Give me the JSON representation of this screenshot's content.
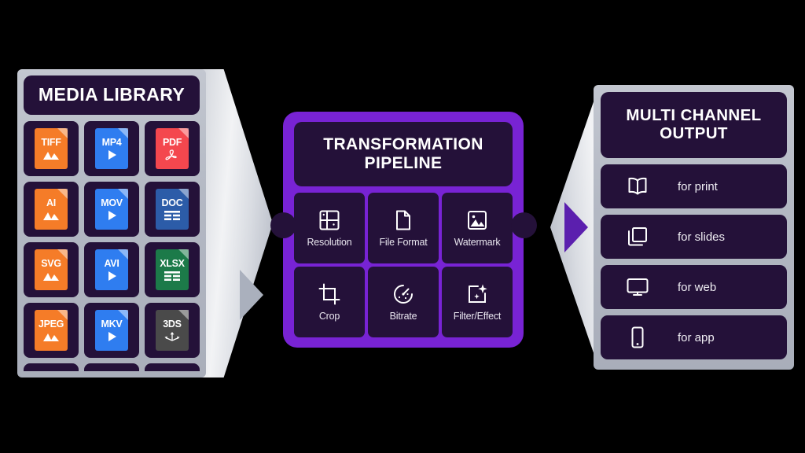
{
  "background_color": "#000000",
  "accent_purple": "#7823D4",
  "panel_dark": "#241139",
  "frame_silver": "#B4B9C4",
  "media_library": {
    "title": "MEDIA LIBRARY",
    "files": [
      {
        "label": "TIFF",
        "color": "#F57C28",
        "glyph": "image-icon"
      },
      {
        "label": "MP4",
        "color": "#2F7DF0",
        "glyph": "play-icon"
      },
      {
        "label": "PDF",
        "color": "#F4474E",
        "glyph": "pdf-icon"
      },
      {
        "label": "AI",
        "color": "#F57C28",
        "glyph": "image-icon"
      },
      {
        "label": "MOV",
        "color": "#2F7DF0",
        "glyph": "play-icon"
      },
      {
        "label": "DOC",
        "color": "#2C5CA8",
        "glyph": "lines-icon"
      },
      {
        "label": "SVG",
        "color": "#F57C28",
        "glyph": "image-icon"
      },
      {
        "label": "AVI",
        "color": "#2F7DF0",
        "glyph": "play-icon"
      },
      {
        "label": "XLSX",
        "color": "#1C7A49",
        "glyph": "table-icon"
      },
      {
        "label": "JPEG",
        "color": "#F57C28",
        "glyph": "image-icon"
      },
      {
        "label": "MKV",
        "color": "#2F7DF0",
        "glyph": "play-icon"
      },
      {
        "label": "3DS",
        "color": "#4A4A4A",
        "glyph": "axis-icon"
      }
    ],
    "empty_cells": 3
  },
  "pipeline": {
    "title_line1": "TRANSFORMATION",
    "title_line2": "PIPELINE",
    "steps": [
      {
        "label": "Resolution",
        "icon": "resolution-icon"
      },
      {
        "label": "File Format",
        "icon": "file-icon"
      },
      {
        "label": "Watermark",
        "icon": "watermark-icon"
      },
      {
        "label": "Crop",
        "icon": "crop-icon"
      },
      {
        "label": "Bitrate",
        "icon": "bitrate-icon"
      },
      {
        "label": "Filter/Effect",
        "icon": "sparkle-icon"
      }
    ]
  },
  "output": {
    "title_line1": "MULTI CHANNEL",
    "title_line2": "OUTPUT",
    "channels": [
      {
        "label": "for print",
        "icon": "book-icon"
      },
      {
        "label": "for slides",
        "icon": "slides-icon"
      },
      {
        "label": "for web",
        "icon": "monitor-icon"
      },
      {
        "label": "for app",
        "icon": "phone-icon"
      }
    ]
  }
}
